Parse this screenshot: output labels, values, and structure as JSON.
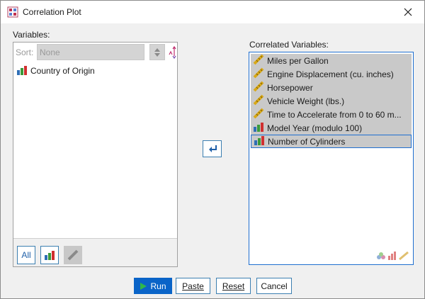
{
  "window": {
    "title": "Correlation Plot"
  },
  "icons": {
    "app": "correlation-plot-icon",
    "close": "close-icon",
    "scale": "ruler-scale-icon",
    "ordinal": "bar-chart-ordinal-icon",
    "nominal": "bar-chart-nominal-icon",
    "move": "move-left-arrow-icon"
  },
  "variables_panel": {
    "label": "Variables:",
    "sort_label": "Sort:",
    "sort_value": "None",
    "items": [
      {
        "label": "Country of Origin",
        "icon": "bar-chart-nominal-icon"
      }
    ],
    "footer": {
      "all_label": "All"
    }
  },
  "correlated_panel": {
    "label": "Correlated Variables:",
    "items": [
      {
        "label": "Miles per Gallon",
        "icon": "ruler-scale-icon"
      },
      {
        "label": "Engine Displacement (cu. inches)",
        "icon": "ruler-scale-icon"
      },
      {
        "label": "Horsepower",
        "icon": "ruler-scale-icon"
      },
      {
        "label": "Vehicle Weight (lbs.)",
        "icon": "ruler-scale-icon"
      },
      {
        "label": "Time to Accelerate from 0 to 60 m...",
        "icon": "ruler-scale-icon"
      },
      {
        "label": "Model Year (modulo 100)",
        "icon": "bar-chart-ordinal-icon"
      },
      {
        "label": "Number of Cylinders",
        "icon": "bar-chart-ordinal-icon"
      }
    ]
  },
  "buttons": {
    "run": "Run",
    "paste": "Paste",
    "reset": "Reset",
    "cancel": "Cancel"
  },
  "colors": {
    "accent": "#0a64c8",
    "selected_row": "#c9c9c9",
    "border_focus": "#1f6fd0"
  }
}
